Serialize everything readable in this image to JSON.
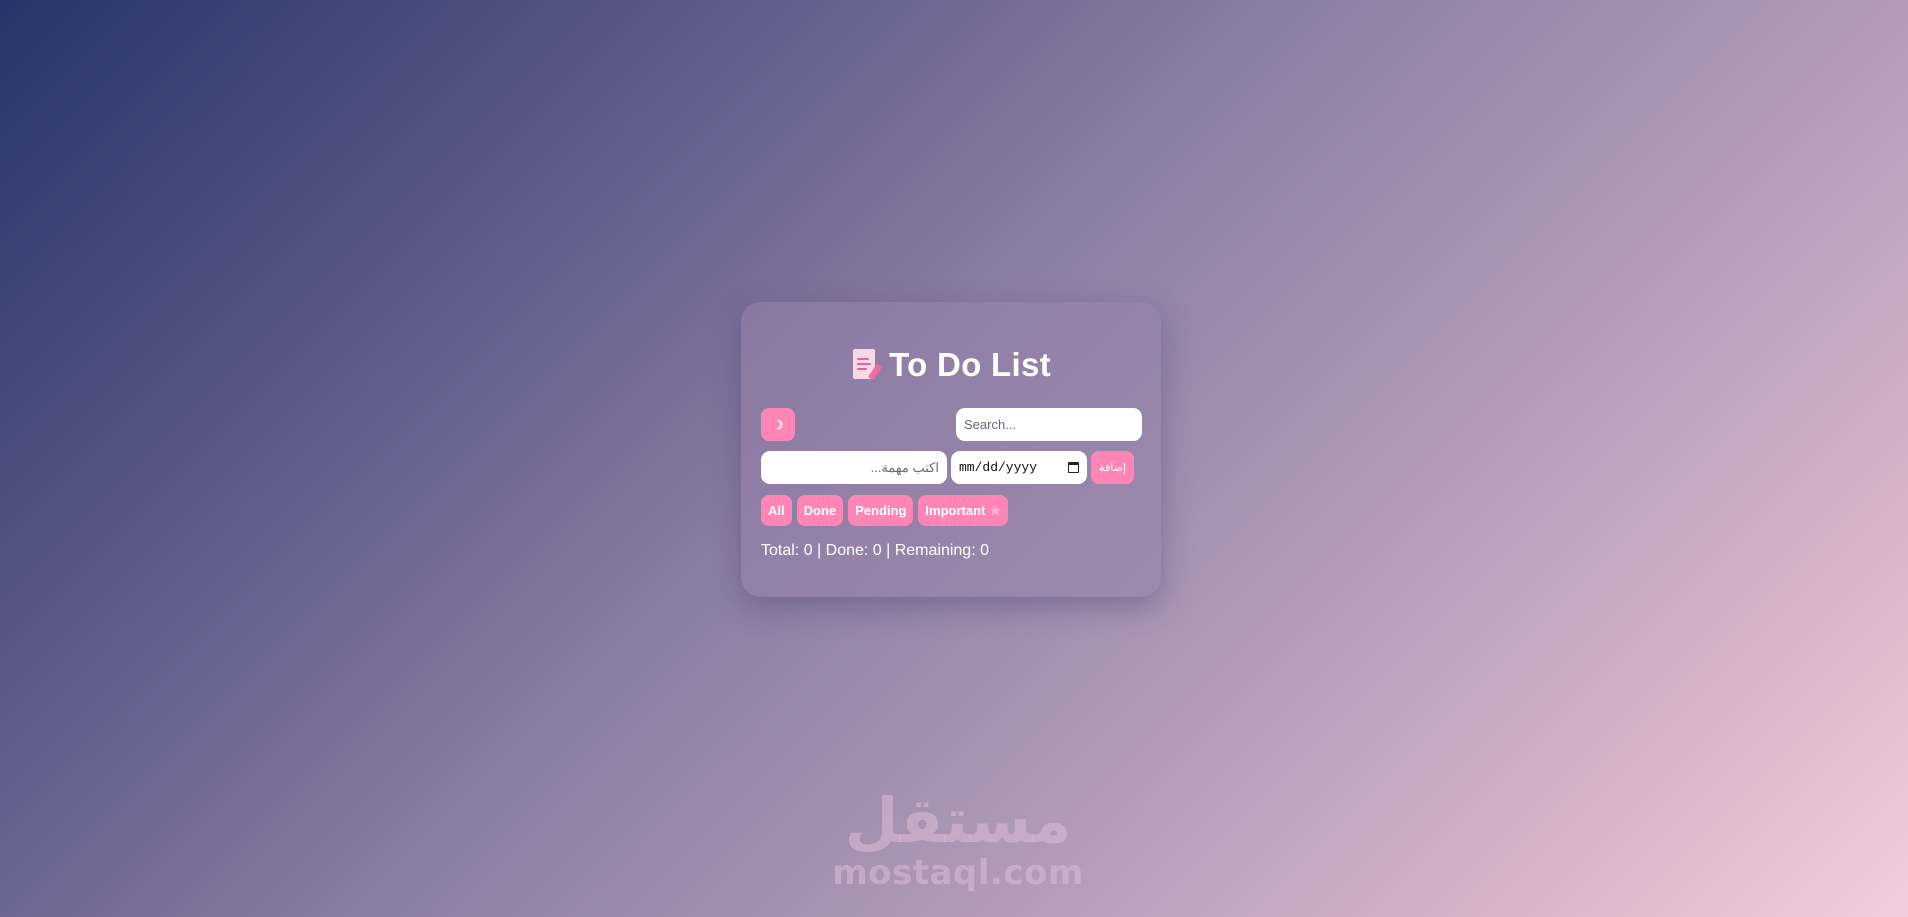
{
  "app": {
    "title": "To Do List",
    "title_icon": "memo-icon"
  },
  "toolbar": {
    "theme_button_label": "☽",
    "search_placeholder": "Search..."
  },
  "task_form": {
    "task_placeholder": "اكتب مهمة...",
    "date_placeholder": "mm/dd/yyyy",
    "add_label": "إضافة"
  },
  "filters": {
    "all": "All",
    "done": "Done",
    "pending": "Pending",
    "important": "Important",
    "important_icon": "★"
  },
  "stats": {
    "text": "Total: 0 | Done: 0 | Remaining: 0"
  },
  "watermark": {
    "arabic": "مستقل",
    "latin": "mostaql.com"
  },
  "colors": {
    "accent": "#ff85b6",
    "card": "#96829f"
  }
}
